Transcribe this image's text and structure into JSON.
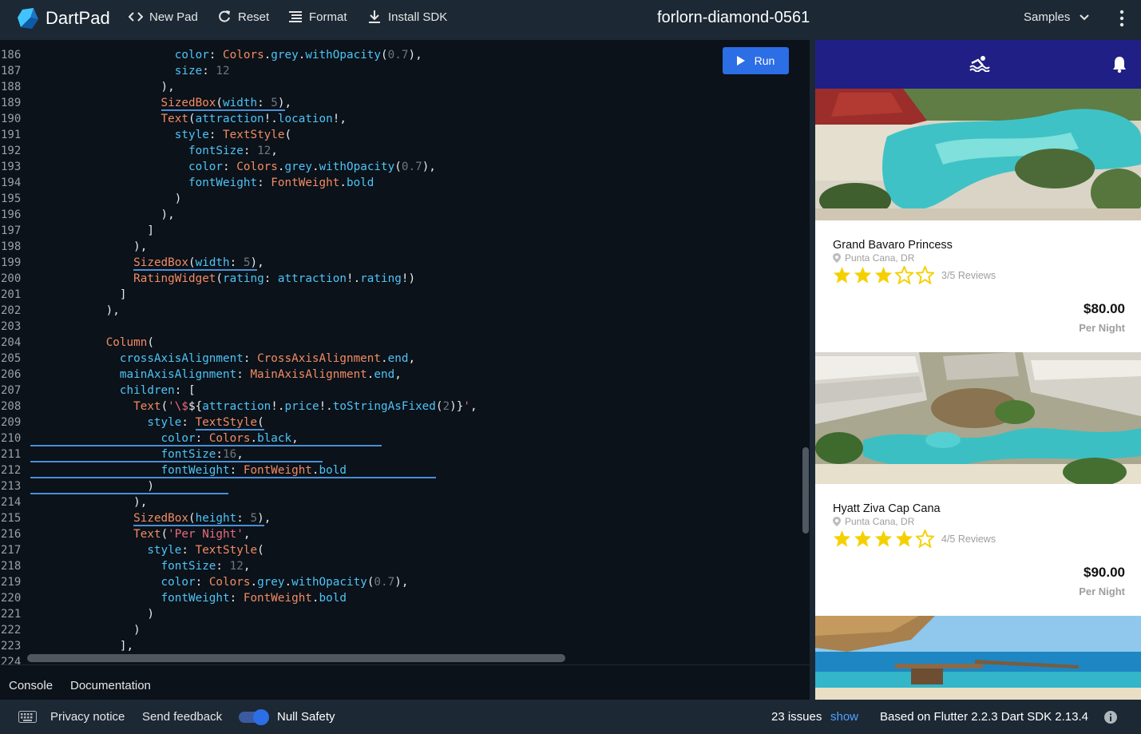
{
  "header": {
    "brand": "DartPad",
    "new_pad": "New Pad",
    "reset": "Reset",
    "format": "Format",
    "install_sdk": "Install SDK",
    "pad_title": "forlorn-diamond-0561",
    "samples": "Samples"
  },
  "editor": {
    "run_label": "Run",
    "line_numbers": [
      "186",
      "187",
      "188",
      "189",
      "190",
      "191",
      "192",
      "193",
      "194",
      "195",
      "196",
      "197",
      "198",
      "199",
      "200",
      "201",
      "202",
      "203",
      "204",
      "205",
      "206",
      "207",
      "208",
      "209",
      "210",
      "211",
      "212",
      "213",
      "214",
      "215",
      "216",
      "217",
      "218",
      "219",
      "220",
      "221",
      "222",
      "223",
      "224"
    ]
  },
  "bottom_tabs": {
    "console": "Console",
    "documentation": "Documentation"
  },
  "preview": {
    "hotels": [
      {
        "name": "Grand Bavaro Princess",
        "location": "Punta Cana, DR",
        "rating": 3,
        "reviews": "3/5 Reviews",
        "price": "$80.00",
        "per_night": "Per Night"
      },
      {
        "name": "Hyatt Ziva Cap Cana",
        "location": "Punta Cana, DR",
        "rating": 4,
        "reviews": "4/5 Reviews",
        "price": "$90.00",
        "per_night": "Per Night"
      }
    ]
  },
  "status": {
    "privacy": "Privacy notice",
    "feedback": "Send feedback",
    "null_safety": "Null Safety",
    "issues": "23 issues",
    "show": "show",
    "version": "Based on Flutter 2.2.3 Dart SDK 2.13.4"
  },
  "colors": {
    "accent": "#2c6ee6",
    "appbar": "#1f1f86",
    "star": "#f5d000"
  }
}
